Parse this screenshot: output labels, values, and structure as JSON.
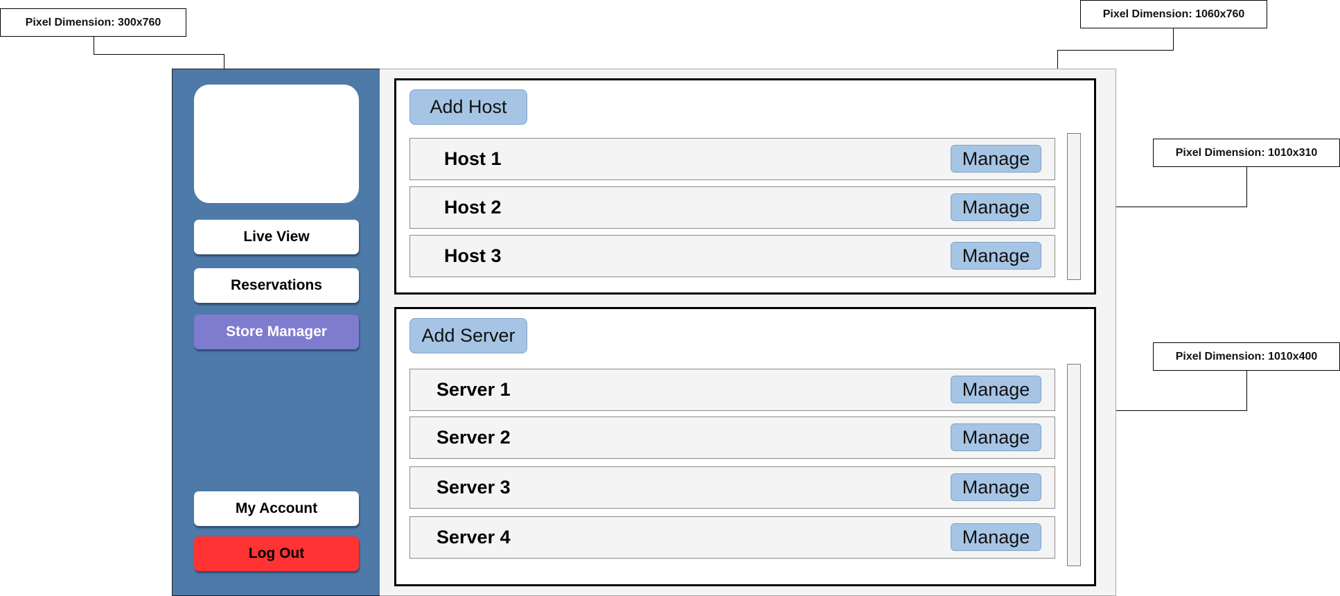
{
  "annotations": {
    "sidebar": "Pixel Dimension: 300x760",
    "main": "Pixel Dimension: 1060x760",
    "hosts_panel": "Pixel Dimension: 1010x310",
    "servers_panel": "Pixel Dimension: 1010x400"
  },
  "sidebar": {
    "logo_placeholder": "",
    "nav": [
      {
        "label": "Live View",
        "state": "default"
      },
      {
        "label": "Reservations",
        "state": "default"
      },
      {
        "label": "Store Manager",
        "state": "active"
      }
    ],
    "account_label": "My Account",
    "logout_label": "Log Out"
  },
  "hosts": {
    "add_label": "Add Host",
    "items": [
      {
        "name": "Host 1",
        "action": "Manage"
      },
      {
        "name": "Host 2",
        "action": "Manage"
      },
      {
        "name": "Host 3",
        "action": "Manage"
      }
    ]
  },
  "servers": {
    "add_label": "Add Server",
    "items": [
      {
        "name": "Server 1",
        "action": "Manage"
      },
      {
        "name": "Server 2",
        "action": "Manage"
      },
      {
        "name": "Server 3",
        "action": "Manage"
      },
      {
        "name": "Server 4",
        "action": "Manage"
      }
    ]
  },
  "colors": {
    "sidebar_bg": "#4d7aa9",
    "active_nav": "#7f7bcf",
    "logout": "#ff3333",
    "button_blue": "#a6c5e4",
    "main_bg": "#f4f4f4"
  }
}
